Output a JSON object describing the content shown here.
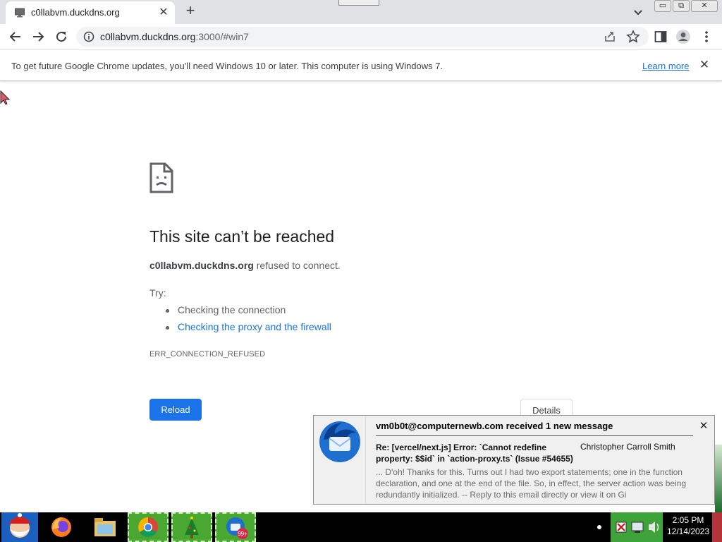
{
  "browser": {
    "tab": {
      "title": "c0llabvm.duckdns.org",
      "close_glyph": "✕"
    },
    "new_tab_glyph": "+",
    "window_buttons": [
      "▭",
      "⧉",
      "✕"
    ],
    "address": {
      "host": "c0llabvm.duckdns.org",
      "path": ":3000/#win7"
    },
    "icons": [
      "back-arrow-icon",
      "forward-arrow-icon",
      "reload-icon",
      "info-icon",
      "share-icon",
      "star-icon",
      "side-panel-icon",
      "profile-icon",
      "kebab-menu-icon",
      "tab-search-icon"
    ]
  },
  "infobar": {
    "message": "To get future Google Chrome updates, you'll need Windows 10 or later. This computer is using Windows 7.",
    "link": "Learn more",
    "close_glyph": "✕"
  },
  "error_page": {
    "title": "This site can’t be reached",
    "host": "c0llabvm.duckdns.org",
    "message_suffix": " refused to connect.",
    "try_label": "Try:",
    "suggestions": [
      "Checking the connection",
      "Checking the proxy and the firewall"
    ],
    "error_code": "ERR_CONNECTION_REFUSED",
    "reload_label": "Reload",
    "details_label": "Details"
  },
  "notification": {
    "header": "vm0b0t@computernewb.com received 1 new message",
    "subject": "Re: [vercel/next.js] Error: `Cannot redefine property: $$id` in `action-proxy.ts` (Issue #54655)",
    "sender": "Christopher Carroll Smith",
    "body": "... D'oh! Thanks for this. Turns out I had two export statements; one in the function declaration, and one at the end of the file. So, in effect, the server action was being redundantly initialized. -- Reply to this email directly or view it on Gi",
    "close_glyph": "✕"
  },
  "taskbar": {
    "apps": [
      "firefox-icon",
      "file-explorer-icon",
      "chrome-icon",
      "christmas-tree-icon",
      "thunderbird-icon"
    ],
    "thunderbird_badge": "99+",
    "clock": {
      "time": "2:05 PM",
      "date": "12/14/2023"
    }
  },
  "colors": {
    "accent": "#1a73e8",
    "tab_strip": "#dfe1e5",
    "taskbar": "#000000",
    "tray_green": "#3ea33a"
  }
}
